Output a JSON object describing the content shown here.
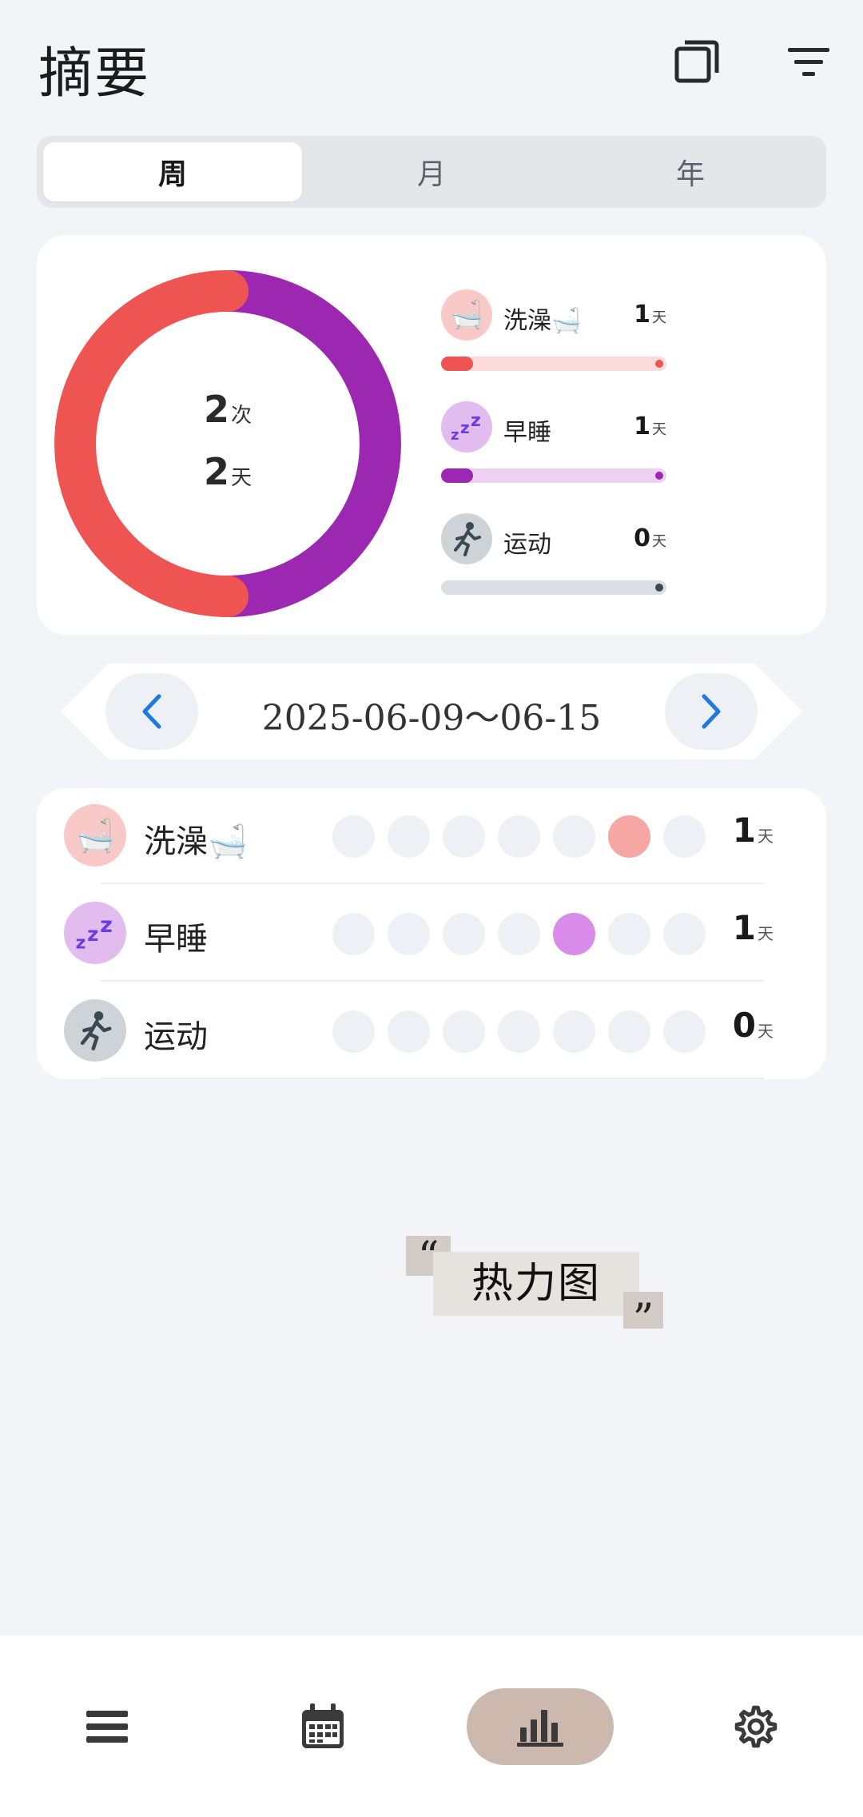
{
  "header": {
    "title": "摘要",
    "icons": [
      "copy-icon",
      "filter-icon"
    ]
  },
  "period_tabs": [
    {
      "label": "周",
      "active": true
    },
    {
      "label": "月",
      "active": false
    },
    {
      "label": "年",
      "active": false
    }
  ],
  "summary": {
    "total_count": "2",
    "count_unit": "次",
    "total_days": "2",
    "days_unit": "天",
    "chart_data": {
      "type": "pie",
      "values": [
        1,
        1
      ],
      "colors": [
        "#ee5552",
        "#9c27b0"
      ]
    },
    "legend": [
      {
        "name": "洗澡🛁",
        "value": "1",
        "unit": "天",
        "icon": "bath-icon",
        "color": "#ee5552",
        "track": "#fbdcda",
        "icon_bg": "#f9c9c7"
      },
      {
        "name": "早睡",
        "value": "1",
        "unit": "天",
        "icon": "zzz-icon",
        "color": "#9c27b0",
        "track": "#ecd1f2",
        "icon_bg": "#e2bcef"
      },
      {
        "name": "运动",
        "value": "0",
        "unit": "天",
        "icon": "running-icon",
        "color": "#3a4a52",
        "track": "#dadfe3",
        "icon_bg": "#cdd3d7"
      }
    ]
  },
  "date_nav": {
    "range": "2025-06-09～06-15",
    "prev_icon": "chevron-left-icon",
    "next_icon": "chevron-right-icon",
    "accent": "#1e7ae0"
  },
  "habits": [
    {
      "name": "洗澡🛁",
      "value": "1",
      "unit": "天",
      "icon": "bath-icon",
      "icon_bg": "#f9c9c7",
      "days": [
        0,
        0,
        0,
        0,
        0,
        1,
        0
      ],
      "active_color": "#f6a7a4"
    },
    {
      "name": "早睡",
      "value": "1",
      "unit": "天",
      "icon": "zzz-icon",
      "icon_bg": "#e2bcef",
      "days": [
        0,
        0,
        0,
        0,
        1,
        0,
        0
      ],
      "active_color": "#d88be8"
    },
    {
      "name": "运动",
      "value": "0",
      "unit": "天",
      "icon": "running-icon",
      "icon_bg": "#cdd3d7",
      "days": [
        0,
        0,
        0,
        0,
        0,
        0,
        0
      ],
      "active_color": "#8a959b"
    }
  ],
  "heatmap_label": {
    "open_quote": "“",
    "text": "热力图",
    "close_quote": "”"
  },
  "bottom_nav": [
    {
      "name": "list-icon",
      "active": false
    },
    {
      "name": "calendar-icon",
      "active": false
    },
    {
      "name": "bar-chart-icon",
      "active": true
    },
    {
      "name": "gear-icon",
      "active": false
    }
  ]
}
